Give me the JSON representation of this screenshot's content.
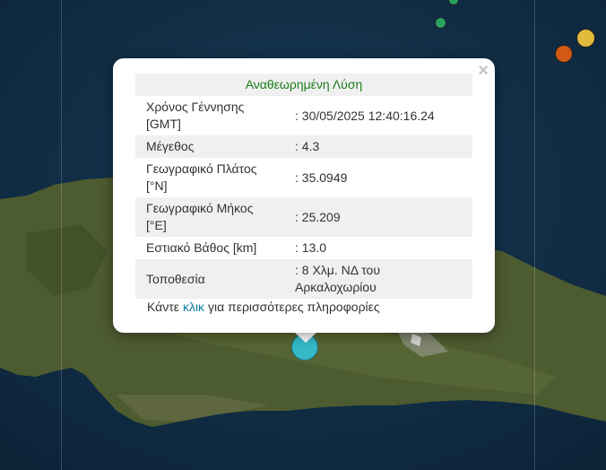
{
  "popup": {
    "header": "Αναθεωρημένη Λύση",
    "close_symbol": "×",
    "rows": [
      {
        "label": "Χρόνος Γέννησης [GMT]",
        "value": ": 30/05/2025 12:40:16.24"
      },
      {
        "label": "Μέγεθος",
        "value": ": 4.3"
      },
      {
        "label": "Γεωγραφικό Πλάτος [°N]",
        "value": ": 35.0949"
      },
      {
        "label": "Γεωγραφικό Μήκος [°E]",
        "value": ": 25.209"
      },
      {
        "label": "Εστιακό Βάθος [km]",
        "value": ": 13.0"
      },
      {
        "label": "Τοποθεσία",
        "value": ": 8 Χλμ. ΝΔ του Αρκαλοχωρίου"
      }
    ],
    "footer_prefix": "Κάντε",
    "footer_link": "κλικ",
    "footer_suffix": "για περισσότερες πληροφορίες"
  },
  "markers": [
    {
      "name": "selected-earthquake",
      "color": "#35b9c7"
    },
    {
      "name": "earthquake-green-1",
      "color": "#27a35f"
    },
    {
      "name": "earthquake-green-2",
      "color": "#27a35f"
    },
    {
      "name": "earthquake-orange",
      "color": "#d05a14"
    },
    {
      "name": "earthquake-yellow",
      "color": "#e3bb3c"
    }
  ],
  "colors": {
    "header_text": "#1a7d1a",
    "link": "#0f7fa8",
    "sea": "#0f2a40",
    "land": "#4a5a2e"
  }
}
